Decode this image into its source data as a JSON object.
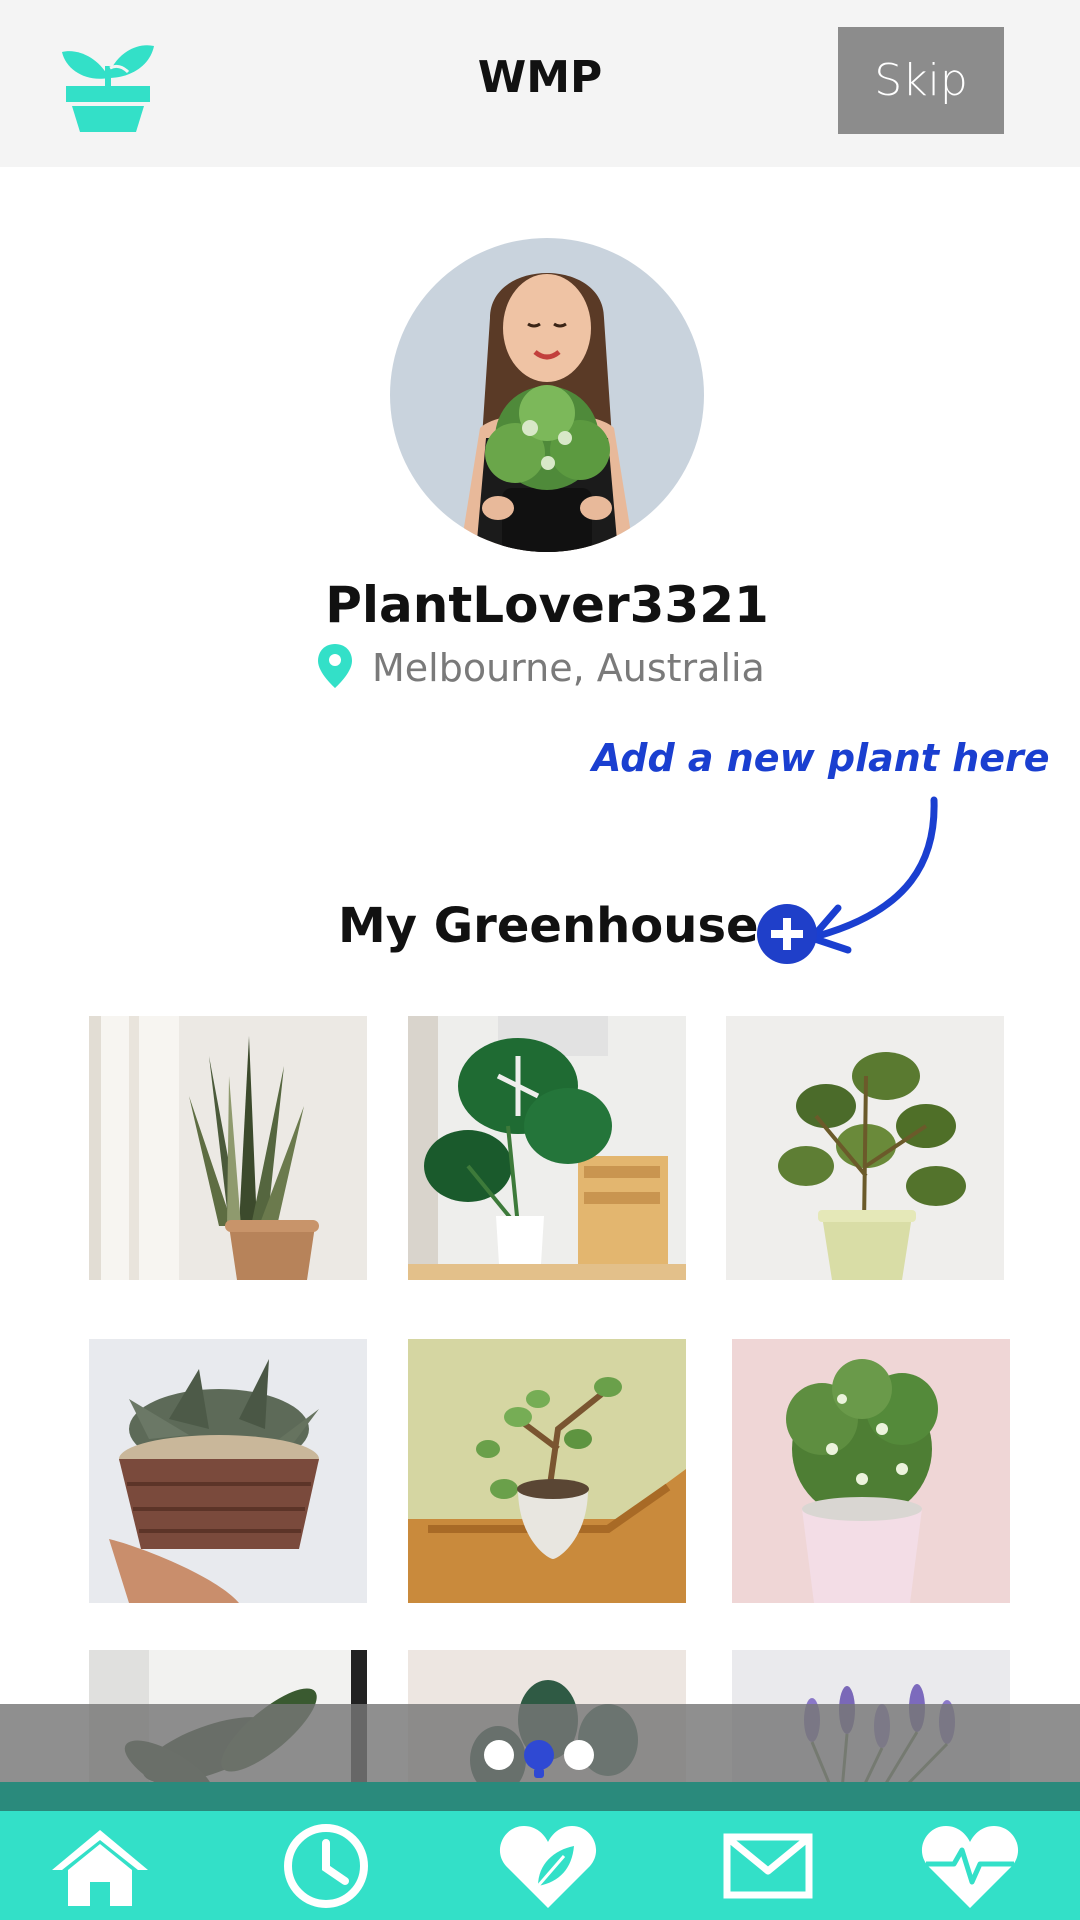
{
  "header": {
    "logo_icon": "potted-plant-icon",
    "title": "WMP",
    "skip_label": "Skip"
  },
  "profile": {
    "username": "PlantLover3321",
    "location": "Melbourne, Australia",
    "location_icon": "map-pin-icon"
  },
  "hint": {
    "text": "Add a new plant here"
  },
  "greenhouse": {
    "title": "My Greenhouse",
    "add_icon": "plus-circle-icon",
    "plants": [
      {
        "name": "snake-plant"
      },
      {
        "name": "monstera"
      },
      {
        "name": "peperomia"
      },
      {
        "name": "kalanchoe"
      },
      {
        "name": "jade-plant"
      },
      {
        "name": "variegated-herb"
      },
      {
        "name": "bird-of-paradise"
      },
      {
        "name": "philodendron"
      },
      {
        "name": "lavender"
      }
    ]
  },
  "pager": {
    "count": 3,
    "active": 2
  },
  "tabbar": {
    "items": [
      {
        "icon": "home-icon"
      },
      {
        "icon": "clock-icon"
      },
      {
        "icon": "heart-leaf-icon"
      },
      {
        "icon": "mail-icon"
      },
      {
        "icon": "heartbeat-icon"
      }
    ]
  },
  "colors": {
    "accent": "#33e0c8",
    "hint_blue": "#1a3fd0",
    "skip_bg": "#8c8c8c",
    "header_bg": "#f4f4f4"
  }
}
